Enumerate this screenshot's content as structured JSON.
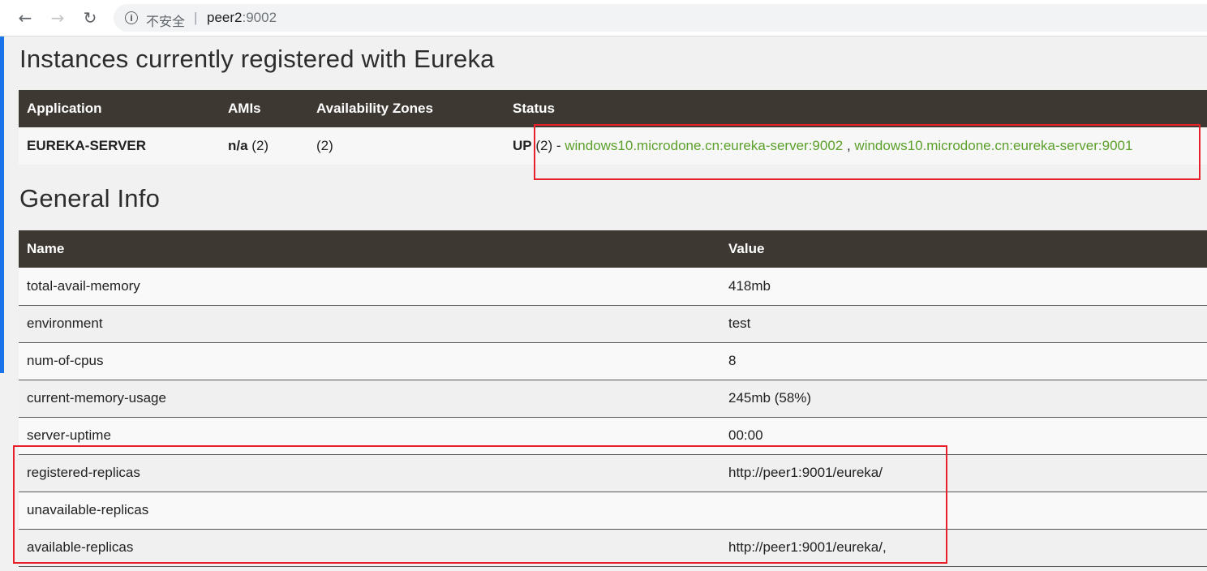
{
  "browser": {
    "security_label": "不安全",
    "separator": "|",
    "url_host": "peer2",
    "url_port": ":9002"
  },
  "instances": {
    "title": "Instances currently registered with Eureka",
    "headers": {
      "application": "Application",
      "amis": "AMIs",
      "zones": "Availability Zones",
      "status": "Status"
    },
    "rows": [
      {
        "application": "EUREKA-SERVER",
        "amis_bold": "n/a",
        "amis_count": " (2)",
        "zones": "(2)",
        "status_up": "UP",
        "status_count": " (2) - ",
        "link1": "windows10.microdone.cn:eureka-server:9002",
        "link_sep": " , ",
        "link2": "windows10.microdone.cn:eureka-server:9001"
      }
    ]
  },
  "general_info": {
    "title": "General Info",
    "headers": {
      "name": "Name",
      "value": "Value"
    },
    "rows": [
      {
        "name": "total-avail-memory",
        "value": "418mb"
      },
      {
        "name": "environment",
        "value": "test"
      },
      {
        "name": "num-of-cpus",
        "value": "8"
      },
      {
        "name": "current-memory-usage",
        "value": "245mb (58%)"
      },
      {
        "name": "server-uptime",
        "value": "00:00"
      },
      {
        "name": "registered-replicas",
        "value": "http://peer1:9001/eureka/"
      },
      {
        "name": "unavailable-replicas",
        "value": ""
      },
      {
        "name": "available-replicas",
        "value": "http://peer1:9001/eureka/,"
      }
    ]
  },
  "colors": {
    "header_bg": "#3d3832",
    "link": "#5ba02a",
    "annotation": "#e8202a"
  },
  "icons": [
    "back-arrow-icon",
    "forward-arrow-icon",
    "reload-icon",
    "info-icon"
  ]
}
